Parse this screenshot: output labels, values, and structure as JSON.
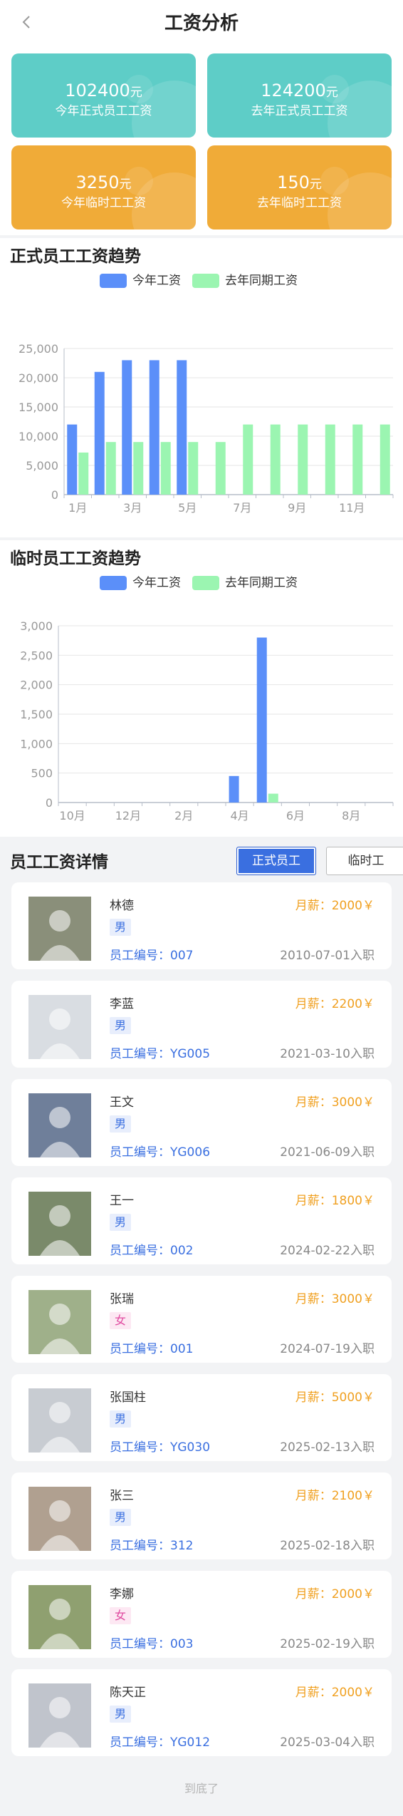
{
  "header": {
    "title": "工资分析",
    "back_icon": "chevron-left-icon"
  },
  "summary_cards": [
    {
      "amount": "102400",
      "unit": "元",
      "label": "今年正式员工工资",
      "color": "#5ecdc7"
    },
    {
      "amount": "124200",
      "unit": "元",
      "label": "去年正式员工工资",
      "color": "#5ecdc7"
    },
    {
      "amount": "3250",
      "unit": "元",
      "label": "今年临时工工资",
      "color": "#f0ab38"
    },
    {
      "amount": "150",
      "unit": "元",
      "label": "去年临时工工资",
      "color": "#f0ab38"
    }
  ],
  "legend": {
    "this_year": "今年工资",
    "last_year": "去年同期工资"
  },
  "colors": {
    "this_year": "#5b8ff9",
    "last_year": "#9bf5b1",
    "accent": "#3a6fe0",
    "salary": "#f0a020"
  },
  "chart_data": [
    {
      "type": "bar",
      "title": "正式员工工资趋势",
      "categories": [
        "1月",
        "2月",
        "3月",
        "4月",
        "5月",
        "6月",
        "7月",
        "8月",
        "9月",
        "10月",
        "11月",
        "12月"
      ],
      "x_tick_labels": [
        "1月",
        "3月",
        "5月",
        "7月",
        "9月",
        "11月"
      ],
      "y_ticks": [
        "0",
        "5,000",
        "10,000",
        "15,000",
        "20,000",
        "25,000"
      ],
      "ylim": [
        0,
        25000
      ],
      "series": [
        {
          "name": "今年工资",
          "values": [
            12000,
            21000,
            23000,
            23000,
            23000,
            null,
            null,
            null,
            null,
            null,
            null,
            null
          ]
        },
        {
          "name": "去年同期工资",
          "values": [
            7200,
            9000,
            9000,
            9000,
            9000,
            9000,
            12000,
            12000,
            12000,
            12000,
            12000,
            12000
          ]
        }
      ]
    },
    {
      "type": "bar",
      "title": "临时员工工资趋势",
      "categories": [
        "10月",
        "11月",
        "12月",
        "1月",
        "2月",
        "3月",
        "4月",
        "5月",
        "6月",
        "7月",
        "8月",
        "9月"
      ],
      "x_tick_labels": [
        "10月",
        "12月",
        "2月",
        "4月",
        "6月",
        "8月"
      ],
      "y_ticks": [
        "0",
        "500",
        "1,000",
        "1,500",
        "2,000",
        "2,500",
        "3,000"
      ],
      "ylim": [
        0,
        3000
      ],
      "series": [
        {
          "name": "今年工资",
          "values": [
            null,
            null,
            null,
            null,
            null,
            null,
            450,
            2800,
            null,
            null,
            null,
            null
          ]
        },
        {
          "name": "去年同期工资",
          "values": [
            null,
            null,
            null,
            null,
            null,
            null,
            null,
            150,
            null,
            null,
            null,
            null
          ]
        }
      ]
    }
  ],
  "details": {
    "title": "员工工资详情",
    "tabs": [
      {
        "label": "正式员工",
        "active": true
      },
      {
        "label": "临时工",
        "active": false
      }
    ],
    "employees": [
      {
        "name": "林德",
        "salary": "月薪：2000￥",
        "gender": "男",
        "gender_type": "male",
        "id": "员工编号：007",
        "date": "2010-07-01入职"
      },
      {
        "name": "李蓝",
        "salary": "月薪：2200￥",
        "gender": "男",
        "gender_type": "male",
        "id": "员工编号：YG005",
        "date": "2021-03-10入职"
      },
      {
        "name": "王文",
        "salary": "月薪：3000￥",
        "gender": "男",
        "gender_type": "male",
        "id": "员工编号：YG006",
        "date": "2021-06-09入职"
      },
      {
        "name": "王一",
        "salary": "月薪：1800￥",
        "gender": "男",
        "gender_type": "male",
        "id": "员工编号：002",
        "date": "2024-02-22入职"
      },
      {
        "name": "张瑞",
        "salary": "月薪：3000￥",
        "gender": "女",
        "gender_type": "female",
        "id": "员工编号：001",
        "date": "2024-07-19入职"
      },
      {
        "name": "张国柱",
        "salary": "月薪：5000￥",
        "gender": "男",
        "gender_type": "male",
        "id": "员工编号：YG030",
        "date": "2025-02-13入职"
      },
      {
        "name": "张三",
        "salary": "月薪：2100￥",
        "gender": "男",
        "gender_type": "male",
        "id": "员工编号：312",
        "date": "2025-02-18入职"
      },
      {
        "name": "李娜",
        "salary": "月薪：2000￥",
        "gender": "女",
        "gender_type": "female",
        "id": "员工编号：003",
        "date": "2025-02-19入职"
      },
      {
        "name": "陈天正",
        "salary": "月薪：2000￥",
        "gender": "男",
        "gender_type": "male",
        "id": "员工编号：YG012",
        "date": "2025-03-04入职"
      }
    ]
  },
  "footer": "到底了"
}
